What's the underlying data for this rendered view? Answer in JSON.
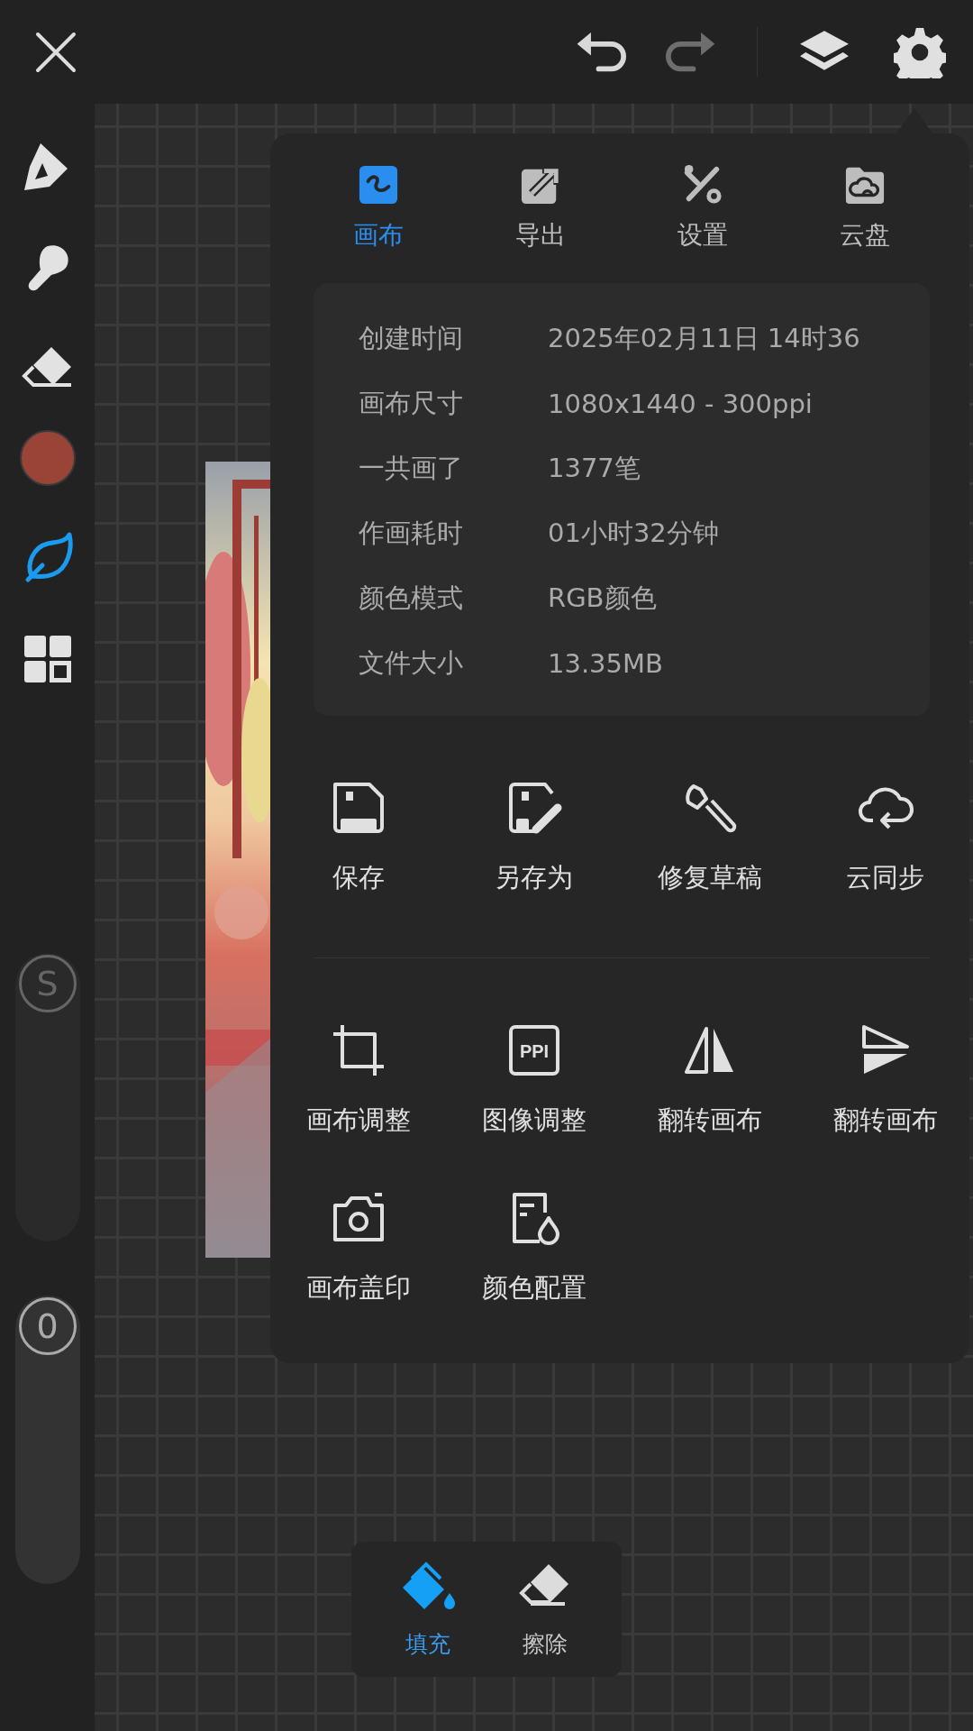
{
  "history": [
    {
      "kind": "undo",
      "disabled": false
    },
    {
      "kind": "redo",
      "disabled": true
    }
  ],
  "tools": [
    {
      "kind": "pen",
      "selected": false
    },
    {
      "kind": "smudge",
      "selected": false
    },
    {
      "kind": "eraser",
      "selected": false
    },
    {
      "kind": "color",
      "color": "#9a4438"
    },
    {
      "kind": "leaf",
      "selected": true
    },
    {
      "kind": "grid",
      "selected": false
    }
  ],
  "sliders": [
    {
      "label": "S",
      "level": 1
    },
    {
      "label": "0",
      "level": 1
    }
  ],
  "menu": {
    "tabs": [
      {
        "label": "画布",
        "kind": "canvas",
        "selected": true
      },
      {
        "label": "导出",
        "kind": "export",
        "selected": false
      },
      {
        "label": "设置",
        "kind": "settings",
        "selected": false
      },
      {
        "label": "云盘",
        "kind": "cloud",
        "selected": false
      }
    ],
    "info": [
      {
        "label": "创建时间",
        "value": "2025年02月11日 14时36"
      },
      {
        "label": "画布尺寸",
        "value": "1080x1440 - 300ppi"
      },
      {
        "label": "一共画了",
        "value": "1377笔"
      },
      {
        "label": "作画耗时",
        "value": "01小时32分钟"
      },
      {
        "label": "颜色模式",
        "value": "RGB颜色"
      },
      {
        "label": "文件大小",
        "value": "13.35MB"
      }
    ],
    "action_groups": [
      [
        {
          "label": "保存",
          "kind": "save"
        },
        {
          "label": "另存为",
          "kind": "save-as"
        },
        {
          "label": "修复草稿",
          "kind": "repair"
        },
        {
          "label": "云同步",
          "kind": "cloud-sync"
        }
      ],
      [
        {
          "label": "画布调整",
          "kind": "crop"
        },
        {
          "label": "图像调整",
          "kind": "ppi",
          "icon_text": "PPI"
        },
        {
          "label": "翻转画布",
          "kind": "flip-h"
        },
        {
          "label": "翻转画布",
          "kind": "flip-v"
        },
        {
          "label": "画布盖印",
          "kind": "camera"
        },
        {
          "label": "颜色配置",
          "kind": "color-doc"
        }
      ]
    ]
  },
  "bottom_tools": [
    {
      "label": "填充",
      "kind": "fill",
      "selected": true
    },
    {
      "label": "擦除",
      "kind": "erase",
      "selected": false
    }
  ]
}
